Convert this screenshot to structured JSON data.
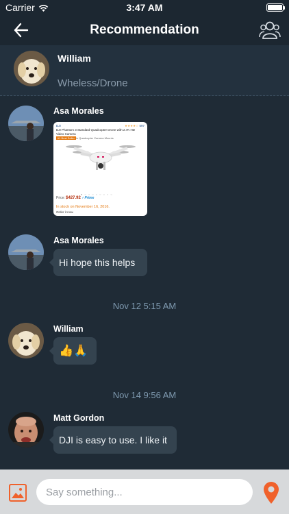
{
  "status": {
    "carrier": "Carrier",
    "time": "3:47 AM"
  },
  "nav": {
    "title": "Recommendation"
  },
  "recommendation": {
    "name": "William",
    "category": "Wheless/Drone"
  },
  "messages": [
    {
      "sender": "Asa Morales",
      "product": {
        "brand": "DJI",
        "rating_count": "597",
        "title": "DJI Phantom 3 Standard Quadcopter Drone with 2.7K HD Video Camera",
        "badge": "#1 Best Seller",
        "category": "in Quadcopter Camera Mounts",
        "price_label": "Price:",
        "price": "$427.92",
        "prime": "✓Prime",
        "stock": "In stock on November 16, 2016.",
        "order": "Order it now."
      }
    },
    {
      "sender": "Asa Morales",
      "text": "Hi hope this helps"
    },
    {
      "timestamp": "Nov 12 5:15 AM"
    },
    {
      "sender": "William",
      "text": "👍🙏"
    },
    {
      "timestamp": "Nov 14 9:56 AM"
    },
    {
      "sender": "Matt Gordon",
      "text": "DJI is easy to use. I like it"
    }
  ],
  "input": {
    "placeholder": "Say something..."
  },
  "icons": {
    "back": "arrow-left-icon",
    "group": "group-icon",
    "image": "image-icon",
    "location": "location-pin-icon",
    "wifi": "wifi-icon",
    "battery": "battery-icon"
  },
  "colors": {
    "background": "#1f2b36",
    "header": "#1c2731",
    "bubble": "#34434f",
    "timestamp": "#7f9ab0",
    "accent": "#f0612b"
  }
}
